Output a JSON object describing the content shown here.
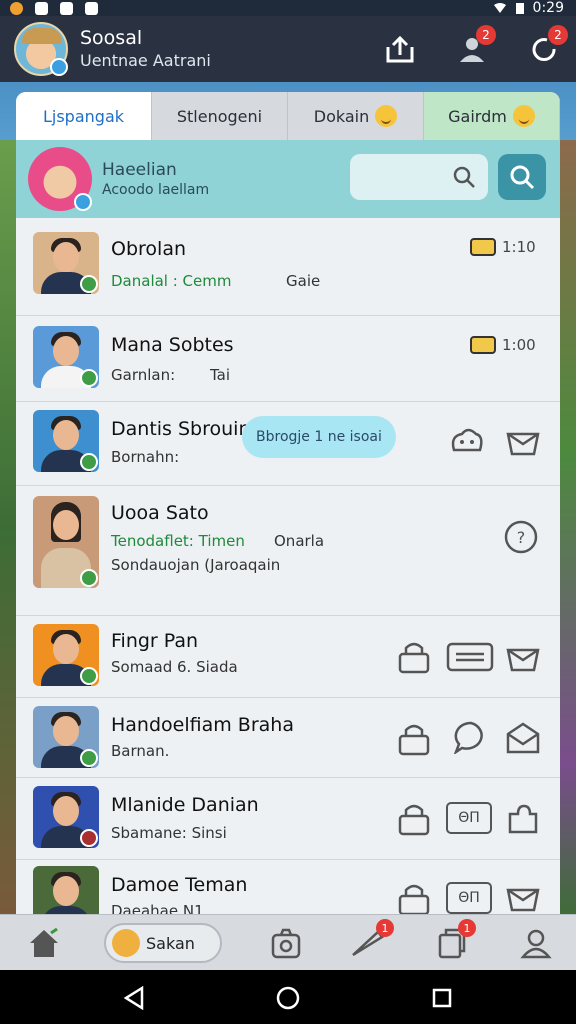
{
  "status_bar": {
    "time": "0:29"
  },
  "app_bar": {
    "title": "Soosal",
    "subtitle": "Uentnae Aatrani",
    "badge_1": "2",
    "badge_2": "2"
  },
  "tabs": [
    {
      "label": "Ljspangak"
    },
    {
      "label": "Stlenogeni"
    },
    {
      "label": "Dokain"
    },
    {
      "label": "Gairdm"
    }
  ],
  "profile": {
    "name": "Haeelian",
    "sub": "Acoodo laellam",
    "search_placeholder": ""
  },
  "contacts": [
    {
      "name": "Obrolan",
      "sub": "Danalal : Cemm",
      "sub2": "Gaie",
      "meta": "1:10"
    },
    {
      "name": "Mana Sobtes",
      "sub": "Garnlan:",
      "sub2": "Tai",
      "meta": "1:00"
    },
    {
      "name": "Dantis Sbrouin",
      "sub": "Bornahn:",
      "bubble": "Bbrogje 1 ne isoai"
    },
    {
      "name": "Uooa Sato",
      "sub": "Tenodaflet: Timen",
      "sub_extra": "Onarla",
      "sub2": "Sondauojan (Jaroaqain"
    },
    {
      "name": "Fingr Pan",
      "sub": "Somaad 6. Siada"
    },
    {
      "name": "Handoelfiam Braha",
      "sub": "Barnan."
    },
    {
      "name": "Mlanide Danian",
      "sub": "Sbamane: Sinsi",
      "icon_text": "ΘΠ"
    },
    {
      "name": "Damoe Teman",
      "sub": "Daeahae N1",
      "icon_text": "ΘΠ"
    }
  ],
  "bottom_nav": {
    "pill_label": "Sakan",
    "badge_a": "1",
    "badge_b": "1"
  },
  "colors": {
    "accent": "#1f6fc7",
    "green": "#1f8a3a",
    "cyan_panel": "#8fd3d7",
    "bubble": "#a9e6f3"
  }
}
